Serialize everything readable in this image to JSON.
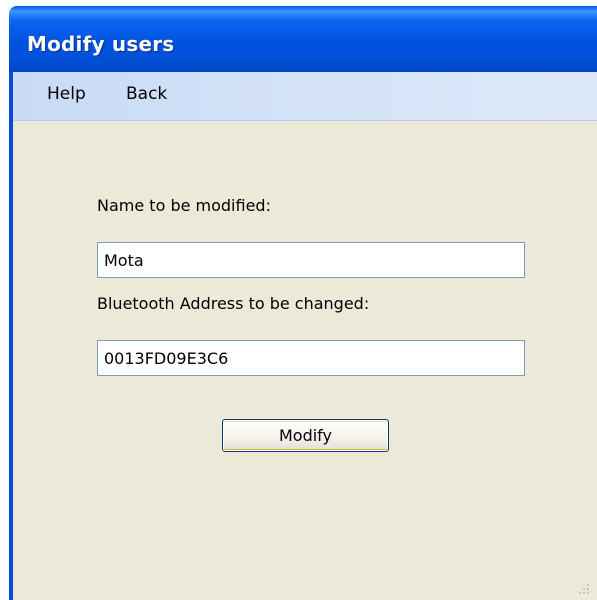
{
  "window": {
    "title": "Modify users"
  },
  "menu": {
    "items": [
      {
        "label": "Help"
      },
      {
        "label": "Back"
      }
    ]
  },
  "form": {
    "name_label": "Name to be modified:",
    "name_value": "Mota",
    "bt_label": "Bluetooth Address to be changed:",
    "bt_value": "0013FD09E3C6",
    "modify_button": "Modify"
  },
  "colors": {
    "titlebar": "#0054e3",
    "menubar": "#d6e4f8",
    "client_background": "#ece9d8",
    "input_border": "#7f9db9"
  },
  "icons": {
    "resize_grip": "resize-grip-icon"
  }
}
